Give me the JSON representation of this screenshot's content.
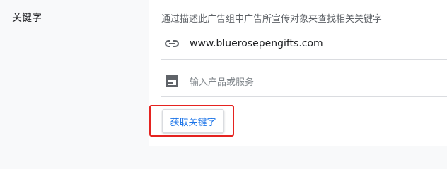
{
  "section": {
    "label": "关键字"
  },
  "keyword_panel": {
    "description": "通过描述此广告组中广告所宣传对象来查找相关关键字",
    "url_value": "www.bluerosepengifts.com",
    "url_icon": "link-icon",
    "product_placeholder": "输入产品或服务",
    "product_icon": "store-icon",
    "get_keywords_label": "获取关键字"
  },
  "colors": {
    "accent": "#1a73e8",
    "highlight": "#e52320",
    "muted_text": "#5f6368",
    "divider": "#dadce0"
  }
}
